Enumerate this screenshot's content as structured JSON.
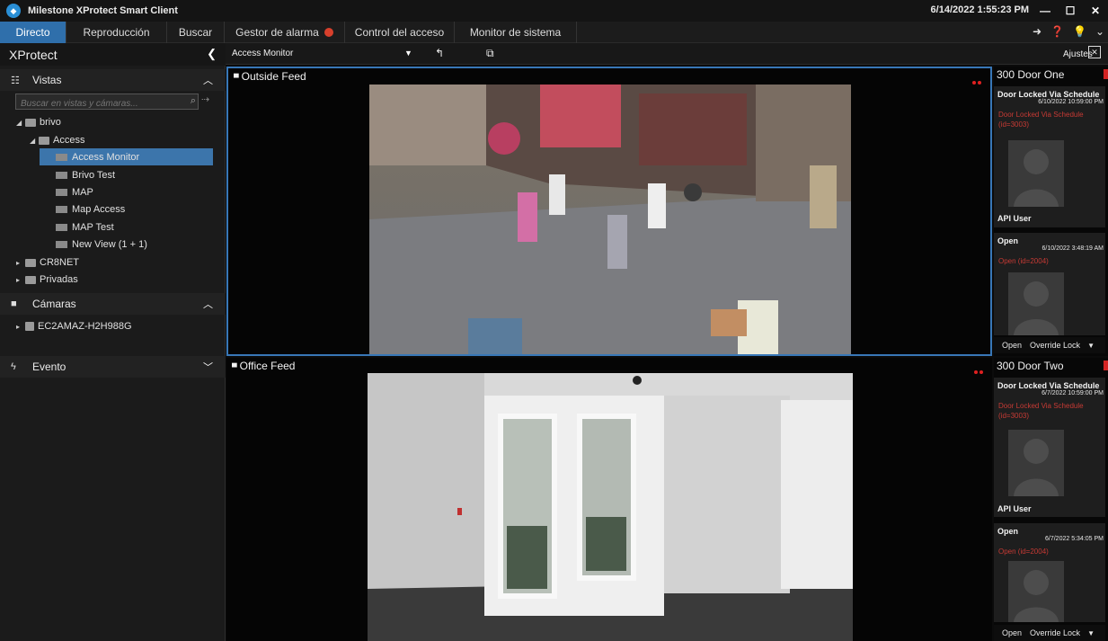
{
  "app": {
    "title": "Milestone XProtect Smart Client",
    "clock": "6/14/2022 1:55:23 PM",
    "window_buttons": [
      "—",
      "☐",
      "✕"
    ]
  },
  "tabs": [
    {
      "label": "Directo",
      "active": true
    },
    {
      "label": "Reproducción"
    },
    {
      "label": "Buscar"
    },
    {
      "label": "Gestor de alarma",
      "badge": true
    },
    {
      "label": "Control del acceso"
    },
    {
      "label": "Monitor de sistema"
    }
  ],
  "tab_icons": [
    "➜",
    "❓",
    "💡",
    "⌄"
  ],
  "left_panel": {
    "header": "XProtect",
    "vistas_label": "Vistas",
    "search_placeholder": "Buscar en vistas y cámaras...",
    "tree": [
      {
        "label": "brivo",
        "type": "folder"
      },
      {
        "label": "Access",
        "type": "folder"
      },
      {
        "label": "Access Monitor",
        "type": "view",
        "selected": true
      },
      {
        "label": "Brivo Test",
        "type": "view"
      },
      {
        "label": "MAP",
        "type": "view"
      },
      {
        "label": "Map Access",
        "type": "view"
      },
      {
        "label": "MAP Test",
        "type": "view"
      },
      {
        "label": "New View (1 + 1)",
        "type": "view"
      },
      {
        "label": "CR8NET",
        "type": "folder"
      },
      {
        "label": "Privadas",
        "type": "folder"
      }
    ],
    "camaras_label": "Cámaras",
    "camera_server": "EC2AMAZ-H2H988G",
    "evento_label": "Evento"
  },
  "view_toolbar": {
    "view_name": "Access Monitor",
    "settings_label": "Ajustes"
  },
  "feeds": [
    {
      "title": "Outside Feed"
    },
    {
      "title": "Office Feed"
    }
  ],
  "doors": [
    {
      "name": "300 Door One",
      "events": [
        {
          "event": "Door Locked Via Schedule",
          "time": "6/10/2022 10:59:00 PM",
          "detail": "Door Locked Via Schedule (id=3003)",
          "user": "API User"
        },
        {
          "event": "Open",
          "time": "6/10/2022 3:48:19 AM",
          "detail": "Open (id=2004)",
          "user": ""
        }
      ],
      "actions": [
        "Open",
        "Override Lock"
      ]
    },
    {
      "name": "300 Door Two",
      "events": [
        {
          "event": "Door Locked Via Schedule",
          "time": "6/7/2022 10:59:00 PM",
          "detail": "Door Locked Via Schedule (id=3003)",
          "user": "API User"
        },
        {
          "event": "Open",
          "time": "6/7/2022 5:34:05 PM",
          "detail": "Open (id=2004)",
          "user": ""
        }
      ],
      "actions": [
        "Open",
        "Override Lock"
      ]
    }
  ]
}
